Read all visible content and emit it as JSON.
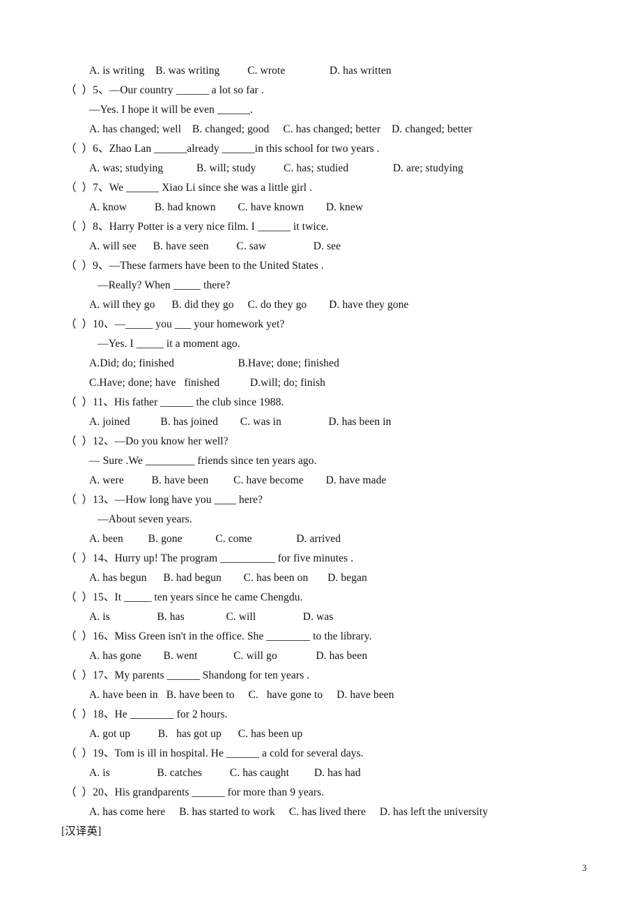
{
  "document": {
    "page_number": "3",
    "section_label": "[汉译英]",
    "lines": [
      {
        "id": "q4-options",
        "indent": "opt",
        "text": "A. is writing    B. was writing          C. wrote                D. has written"
      },
      {
        "id": "q5-stem",
        "indent": "marker",
        "text": "（  ）5、—Our country ______ a lot so far ."
      },
      {
        "id": "q5-reply",
        "indent": "cont",
        "text": "—Yes. I hope it will be even ______."
      },
      {
        "id": "q5-options",
        "indent": "opt",
        "text": "A. has changed; well    B. changed; good     C. has changed; better    D. changed; better"
      },
      {
        "id": "q6-stem",
        "indent": "marker",
        "text": "（  ）6、Zhao Lan ______already ______in this school for two years ."
      },
      {
        "id": "q6-options",
        "indent": "opt",
        "text": "A. was; studying            B. will; study          C. has; studied                D. are; studying"
      },
      {
        "id": "q7-stem",
        "indent": "marker",
        "text": "（  ）7、We ______ Xiao Li since she was a little girl ."
      },
      {
        "id": "q7-options",
        "indent": "opt",
        "text": "A. know          B. had known        C. have known        D. knew"
      },
      {
        "id": "q8-stem",
        "indent": "marker",
        "text": "（  ）8、Harry Potter is a very nice film. I ______ it twice."
      },
      {
        "id": "q8-options",
        "indent": "opt",
        "text": "A. will see      B. have seen          C. saw                 D. see"
      },
      {
        "id": "q9-stem",
        "indent": "marker",
        "text": "（  ）9、—These farmers have been to the United States ."
      },
      {
        "id": "q9-reply",
        "indent": "cont2",
        "text": "—Really? When _____ there?"
      },
      {
        "id": "q9-options",
        "indent": "opt",
        "text": "A. will they go      B. did they go     C. do they go        D. have they gone"
      },
      {
        "id": "q10-stem",
        "indent": "marker",
        "text": "（  ）10、—_____ you ___ your homework yet?"
      },
      {
        "id": "q10-reply",
        "indent": "cont2",
        "text": "—Yes. I _____ it a moment ago."
      },
      {
        "id": "q10-optionsAB",
        "indent": "opt",
        "text": "A.Did; do; finished                       B.Have; done; finished"
      },
      {
        "id": "q10-optionsCD",
        "indent": "opt",
        "text": "C.Have; done; have   finished           D.will; do; finish"
      },
      {
        "id": "q11-stem",
        "indent": "marker",
        "text": "（  ）11、His father ______ the club since 1988."
      },
      {
        "id": "q11-options",
        "indent": "opt",
        "text": "A. joined           B. has joined        C. was in                 D. has been in"
      },
      {
        "id": "q12-stem",
        "indent": "marker",
        "text": "（  ）12、—Do you know her well?"
      },
      {
        "id": "q12-reply",
        "indent": "cont",
        "text": "— Sure .We _________ friends since ten years ago."
      },
      {
        "id": "q12-options",
        "indent": "opt",
        "text": "A. were          B. have been         C. have become        D. have made"
      },
      {
        "id": "q13-stem",
        "indent": "marker",
        "text": "（  ）13、—How long have you ____ here?"
      },
      {
        "id": "q13-reply",
        "indent": "cont2",
        "text": "—About seven years."
      },
      {
        "id": "q13-options",
        "indent": "opt",
        "text": "A. been         B. gone            C. come                D. arrived"
      },
      {
        "id": "q14-stem",
        "indent": "marker",
        "text": "（  ）14、Hurry up! The program __________ for five minutes ."
      },
      {
        "id": "q14-options",
        "indent": "opt",
        "text": "A. has begun      B. had begun        C. has been on       D. began"
      },
      {
        "id": "q15-stem",
        "indent": "marker",
        "text": "（  ）15、It _____ ten years since he came Chengdu."
      },
      {
        "id": "q15-options",
        "indent": "opt",
        "text": "A. is                 B. has               C. will                 D. was"
      },
      {
        "id": "q16-stem",
        "indent": "marker",
        "text": "（  ）16、Miss Green isn't in the office. She ________ to the library."
      },
      {
        "id": "q16-options",
        "indent": "opt",
        "text": "A. has gone        B. went             C. will go              D. has been"
      },
      {
        "id": "q17-stem",
        "indent": "marker",
        "text": "（  ）17、My parents ______ Shandong for ten years ."
      },
      {
        "id": "q17-options",
        "indent": "opt",
        "text": "A. have been in   B. have been to     C.   have gone to     D. have been"
      },
      {
        "id": "q18-stem",
        "indent": "marker",
        "text": "（  ）18、He ________ for 2 hours."
      },
      {
        "id": "q18-options",
        "indent": "opt",
        "text": "A. got up          B.   has got up      C. has been up"
      },
      {
        "id": "q19-stem",
        "indent": "marker",
        "text": "（  ）19、Tom is ill in hospital. He ______ a cold for several days."
      },
      {
        "id": "q19-options",
        "indent": "opt",
        "text": "A. is                 B. catches          C. has caught         D. has had"
      },
      {
        "id": "q20-stem",
        "indent": "marker",
        "text": "（  ）20、His grandparents ______ for more than 9 years."
      },
      {
        "id": "q20-options",
        "indent": "opt",
        "text": "A. has come here     B. has started to work     C. has lived there     D. has left the university"
      }
    ]
  }
}
